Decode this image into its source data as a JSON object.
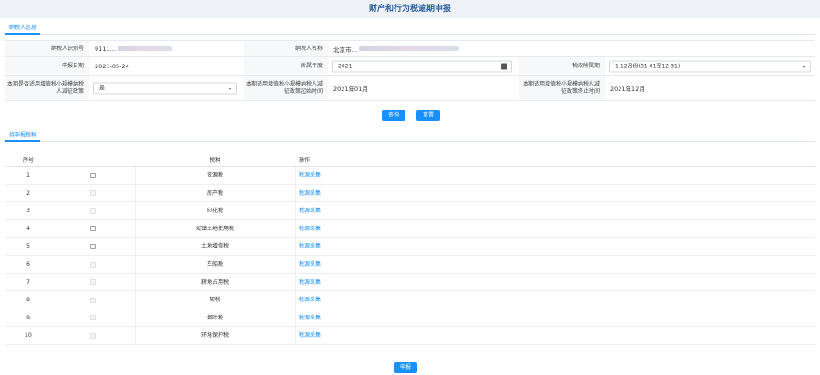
{
  "page_title": "财产和行为税逾期申报",
  "tabs": {
    "taxpayer_info": "纳税人信息",
    "pending_taxes": "待申报税种"
  },
  "info": {
    "taxpayer_id_label": "纳税人识别号",
    "taxpayer_id_value": "9111…",
    "taxpayer_name_label": "纳税人名称",
    "taxpayer_name_value": "北京市…",
    "filing_date_label": "申报日期",
    "filing_date_value": "2021-05-24",
    "belong_year_label": "所属年度",
    "belong_year_value": "2021",
    "period_label": "税款所属期",
    "period_value": "1-12月份(01-01至12-31)",
    "small_taxpayer_label": "本期是否适用增值税小规模纳税人减征政策",
    "small_taxpayer_value": "是",
    "policy_start_label": "本期适用增值税小规模纳税人减征政策起始时间",
    "policy_start_value": "2021年01月",
    "policy_end_label": "本期适用增值税小规模纳税人减征政策终止时间",
    "policy_end_value": "2021年12月"
  },
  "buttons": {
    "query": "查询",
    "reset": "重置",
    "submit": "申报"
  },
  "table": {
    "headers": [
      "序号",
      "",
      "税种",
      "操作"
    ],
    "rows": [
      {
        "no": "1",
        "tax": "资源税",
        "action": "税源采集",
        "checkbox": "enabled"
      },
      {
        "no": "2",
        "tax": "房产税",
        "action": "税源采集",
        "checkbox": "disabled"
      },
      {
        "no": "3",
        "tax": "印花税",
        "action": "税源采集",
        "checkbox": "disabled"
      },
      {
        "no": "4",
        "tax": "城镇土地使用税",
        "action": "税源采集",
        "checkbox": "enabled"
      },
      {
        "no": "5",
        "tax": "土地增值税",
        "action": "税源采集",
        "checkbox": "enabled"
      },
      {
        "no": "6",
        "tax": "车船税",
        "action": "税源采集",
        "checkbox": "disabled"
      },
      {
        "no": "7",
        "tax": "耕地占用税",
        "action": "税源采集",
        "checkbox": "disabled"
      },
      {
        "no": "8",
        "tax": "契税",
        "action": "税源采集",
        "checkbox": "disabled"
      },
      {
        "no": "9",
        "tax": "烟叶税",
        "action": "税源采集",
        "checkbox": "disabled"
      },
      {
        "no": "10",
        "tax": "环境保护税",
        "action": "税源采集",
        "checkbox": "disabled"
      }
    ]
  },
  "colors": {
    "accent": "#1890ff",
    "title": "#2d5fa3",
    "header_bg": "#eef2f7"
  }
}
